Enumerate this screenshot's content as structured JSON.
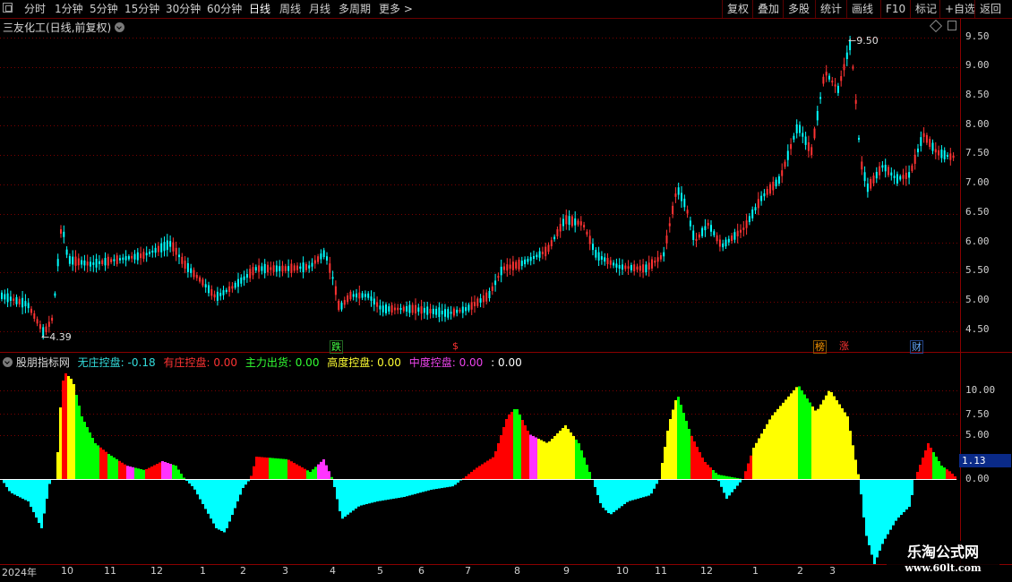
{
  "toolbar": {
    "periods": [
      "分时",
      "1分钟",
      "5分钟",
      "15分钟",
      "30分钟",
      "60分钟",
      "日线",
      "周线",
      "月线",
      "多周期",
      "更多 >"
    ],
    "active_period": "日线",
    "right_buttons": [
      "复权",
      "叠加",
      "多股",
      "统计",
      "画线",
      "F10",
      "标记",
      "+自选",
      "返回"
    ]
  },
  "price_panel": {
    "title": "三友化工(日线,前复权)",
    "high_label": "9.50",
    "low_label": "4.39",
    "y_ticks": [
      "9.50",
      "9.00",
      "8.50",
      "8.00",
      "7.50",
      "7.00",
      "6.50",
      "6.00",
      "5.50",
      "5.00",
      "4.50"
    ],
    "markers": [
      {
        "text": "跌",
        "color": "#44ff44"
      },
      {
        "text": "$",
        "color": "#ff3333"
      },
      {
        "text": "榜",
        "color": "#ff9900"
      },
      {
        "text": "涨",
        "color": "#ff3333"
      },
      {
        "text": "财",
        "color": "#66aaff"
      }
    ]
  },
  "indicator_panel": {
    "title": "股朋指标网",
    "legend": [
      {
        "label": "无庄控盘:",
        "value": "-0.18",
        "color": "#33dddd"
      },
      {
        "label": "有庄控盘:",
        "value": "0.00",
        "color": "#ff3333"
      },
      {
        "label": "主力出货:",
        "value": "0.00",
        "color": "#33ff33"
      },
      {
        "label": "高度控盘:",
        "value": "0.00",
        "color": "#ffff33"
      },
      {
        "label": "中度控盘:",
        "value": "0.00",
        "color": "#ee44ee"
      },
      {
        "label": ":",
        "value": "0.00",
        "color": "#ffffff"
      }
    ],
    "y_ticks": [
      "10.00",
      "7.50",
      "5.00",
      "0.00"
    ],
    "current_value": "1.13"
  },
  "time_axis": [
    "2024年",
    "10",
    "11",
    "12",
    "1",
    "2",
    "3",
    "4",
    "5",
    "6",
    "7",
    "8",
    "9",
    "10",
    "11",
    "12",
    "1",
    "2",
    "3"
  ],
  "watermark": {
    "line1": "乐淘公式网",
    "line2": "www.60lt.com"
  },
  "colors": {
    "up": "#ff3333",
    "down": "#00ffff",
    "grid": "#7a0000",
    "cyan": "#00ffff",
    "red": "#ff0000",
    "green": "#00ff00",
    "yellow": "#ffff00",
    "magenta": "#ff33ff"
  }
}
